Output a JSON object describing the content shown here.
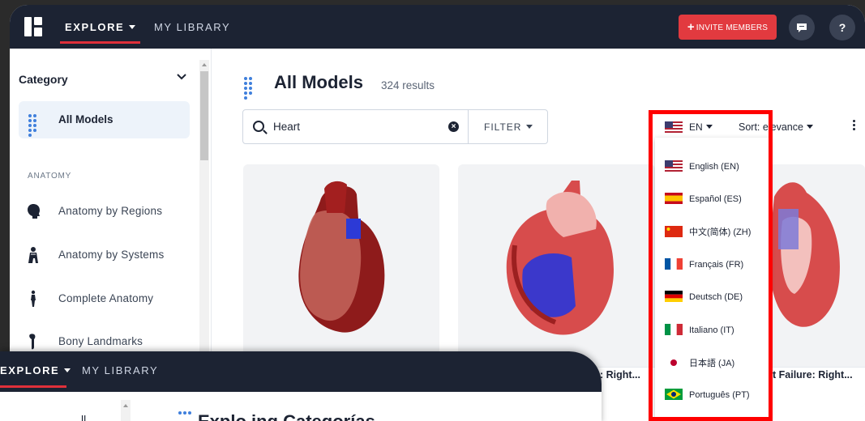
{
  "topbar": {
    "nav_explore": "EXPLORE",
    "nav_library": "MY LIBRARY",
    "invite_label": "INVITE MEMBERS",
    "help_label": "?",
    "accent_color": "#e23a3f"
  },
  "sidebar": {
    "category_title": "Category",
    "all_models": "All Models",
    "section_label": "ANATOMY",
    "items": [
      {
        "label": "Anatomy by Regions",
        "icon": "head-icon"
      },
      {
        "label": "Anatomy by Systems",
        "icon": "body-systems-icon"
      },
      {
        "label": "Complete Anatomy",
        "icon": "human-figure-icon"
      },
      {
        "label": "Bony Landmarks",
        "icon": "bone-icon"
      }
    ]
  },
  "main": {
    "title": "All Models",
    "results": "324 results",
    "search_value": "Heart",
    "filter_label": "FILTER",
    "lang_current": "EN",
    "sort_label": "Sort:",
    "sort_value": "elevance",
    "cards": [
      {
        "title": ""
      },
      {
        "title": ": Right..."
      },
      {
        "title": "t Failure: Right..."
      }
    ]
  },
  "language_dropdown": {
    "options": [
      {
        "label": "English (EN)",
        "flag": "us-flag"
      },
      {
        "label": "Español (ES)",
        "flag": "es-flag"
      },
      {
        "label": "中文(简体) (ZH)",
        "flag": "cn-flag"
      },
      {
        "label": "Français (FR)",
        "flag": "fr-flag"
      },
      {
        "label": "Deutsch (DE)",
        "flag": "de-flag"
      },
      {
        "label": "Italiano (IT)",
        "flag": "it-flag"
      },
      {
        "label": "日本語 (JA)",
        "flag": "jp-flag"
      },
      {
        "label": "Português (PT)",
        "flag": "br-flag"
      }
    ],
    "highlight_color": "#ff0000"
  },
  "overlay": {
    "nav_explore": "EXPLORE",
    "nav_library": "MY LIBRARY",
    "partial_left": "ll",
    "partial_title": "Explo.ing Categorías"
  }
}
